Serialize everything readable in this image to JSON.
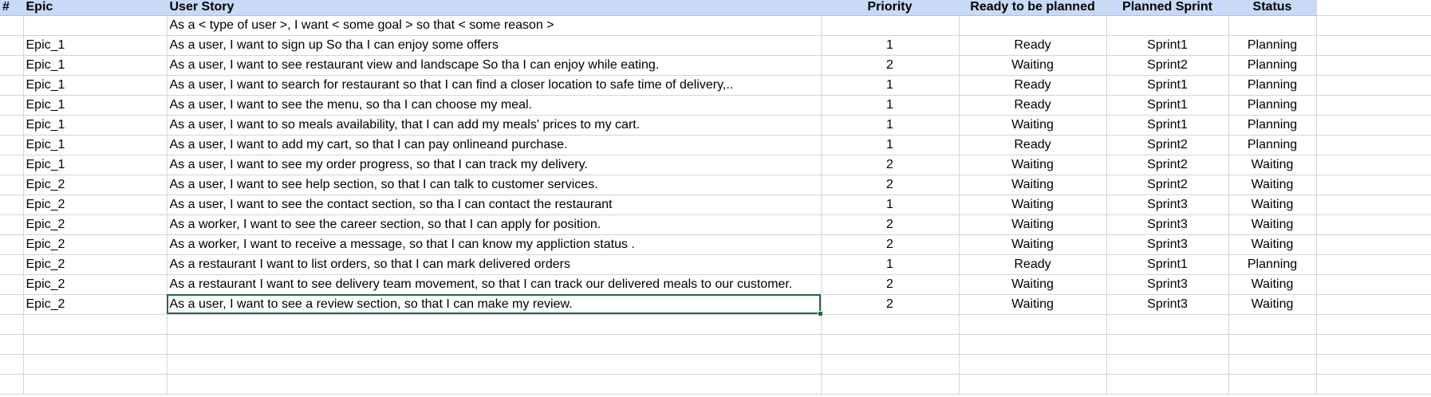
{
  "headers": {
    "num": "#",
    "epic": "Epic",
    "story": "User Story",
    "priority": "Priority",
    "ready": "Ready to be planned",
    "sprint": "Planned Sprint",
    "status": "Status"
  },
  "placeholder": "As a < type of user >, I want < some goal > so that < some reason >",
  "rows": [
    {
      "epic": "Epic_1",
      "story": "As a user, I want to sign up So tha I can enjoy some offers",
      "priority": "1",
      "ready": "Ready",
      "sprint": "Sprint1",
      "status": "Planning"
    },
    {
      "epic": "Epic_1",
      "story": "As a user, I want to see restaurant view and landscape So tha I can enjoy while eating.",
      "priority": "2",
      "ready": "Waiting",
      "sprint": "Sprint2",
      "status": "Planning"
    },
    {
      "epic": "Epic_1",
      "story": "As a user, I want to search for restaurant so that I can find a closer location to safe time of delivery,..",
      "priority": "1",
      "ready": "Ready",
      "sprint": "Sprint1",
      "status": "Planning"
    },
    {
      "epic": "Epic_1",
      "story": "As a user, I want to see the menu, so tha I can choose my meal.",
      "priority": "1",
      "ready": "Ready",
      "sprint": "Sprint1",
      "status": "Planning"
    },
    {
      "epic": "Epic_1",
      "story": "As a user, I want to so meals availability, that I can add my meals' prices to my cart.",
      "priority": "1",
      "ready": "Waiting",
      "sprint": "Sprint1",
      "status": "Planning"
    },
    {
      "epic": "Epic_1",
      "story": "As a user, I want to add my cart, so that I can pay onlineand purchase.",
      "priority": "1",
      "ready": "Ready",
      "sprint": "Sprint2",
      "status": "Planning"
    },
    {
      "epic": "Epic_1",
      "story": "As a user, I want to see my order progress, so that I can track my delivery.",
      "priority": "2",
      "ready": "Waiting",
      "sprint": "Sprint2",
      "status": "Waiting"
    },
    {
      "epic": "Epic_2",
      "story": "As a user, I want to see help section, so that I can talk to customer services.",
      "priority": "2",
      "ready": "Waiting",
      "sprint": "Sprint2",
      "status": "Waiting"
    },
    {
      "epic": "Epic_2",
      "story": "As a user, I want to see the contact section, so tha I can contact the restaurant",
      "priority": "1",
      "ready": "Waiting",
      "sprint": "Sprint3",
      "status": "Waiting"
    },
    {
      "epic": "Epic_2",
      "story": "As a worker, I want to see the career section, so that I can apply for position.",
      "priority": "2",
      "ready": "Waiting",
      "sprint": "Sprint3",
      "status": "Waiting"
    },
    {
      "epic": "Epic_2",
      "story": "As a worker, I want to receive a message, so that I can know my appliction status .",
      "priority": "2",
      "ready": "Waiting",
      "sprint": "Sprint3",
      "status": "Waiting"
    },
    {
      "epic": "Epic_2",
      "story": "As a restaurant I want to list orders, so that I can mark delivered orders",
      "priority": "1",
      "ready": "Ready",
      "sprint": "Sprint1",
      "status": "Planning"
    },
    {
      "epic": "Epic_2",
      "story": "As a restaurant I want to see delivery team movement, so that I can track our delivered meals to our customer.",
      "priority": "2",
      "ready": "Waiting",
      "sprint": "Sprint3",
      "status": "Waiting"
    },
    {
      "epic": "Epic_2",
      "story": "As a user, I want to see a review section, so that I can make my review.",
      "priority": "2",
      "ready": "Waiting",
      "sprint": "Sprint3",
      "status": "Waiting"
    }
  ],
  "colors": {
    "header_bg": "#c9daf8",
    "grid_line": "#d4d4d4",
    "selection": "#1e6b3a",
    "placeholder_text": "#9e9e9e"
  }
}
